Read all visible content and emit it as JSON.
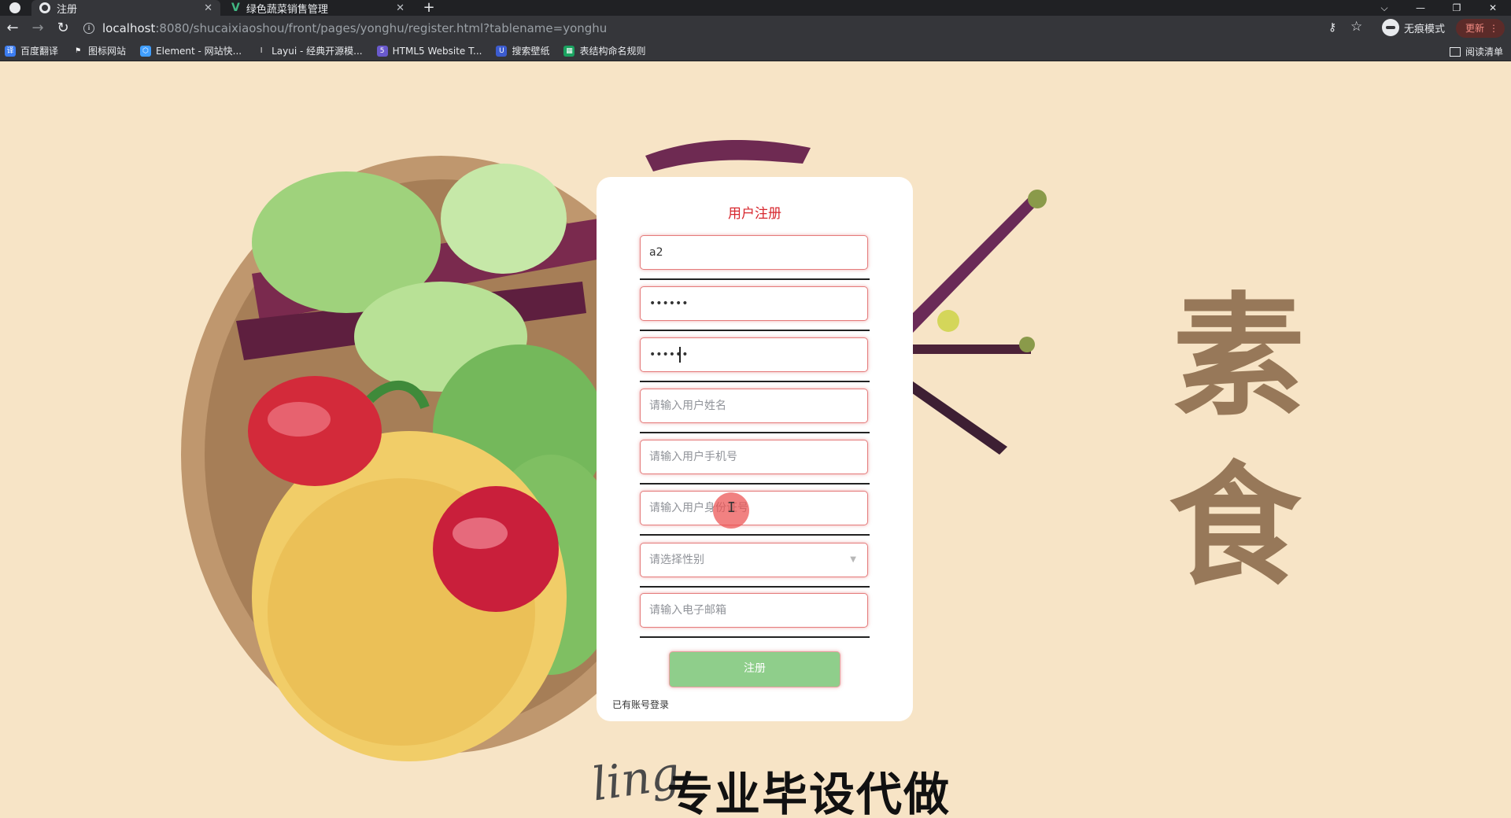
{
  "browser": {
    "tabs": [
      {
        "title": "注册",
        "close": "✕"
      },
      {
        "title": "绿色蔬菜销售管理",
        "close": "✕"
      }
    ],
    "new_tab": "+",
    "window_controls": [
      "⌵",
      "—",
      "❐",
      "✕"
    ],
    "nav": {
      "back": "←",
      "forward": "→",
      "reload": "↻"
    },
    "url_host": "localhost",
    "url_rest": ":8080/shucaixiaoshou/front/pages/yonghu/register.html?tablename=yonghu",
    "incognito_label": "无痕模式",
    "update_label": "更新",
    "update_menu": "⋮",
    "bookmarks": [
      {
        "label": "百度翻译",
        "icon": "baidu-translate-icon",
        "color": "#3b7cf0",
        "glyph": "译"
      },
      {
        "label": "图标网站",
        "icon": "flag-icon",
        "color": "#35363a",
        "glyph": "⚑"
      },
      {
        "label": "Element - 网站快...",
        "icon": "element-icon",
        "color": "#409eff",
        "glyph": "⬡"
      },
      {
        "label": "Layui - 经典开源模...",
        "icon": "layui-icon",
        "color": "#35363a",
        "glyph": "l"
      },
      {
        "label": "HTML5 Website T...",
        "icon": "html5-icon",
        "color": "#6a5acd",
        "glyph": "5"
      },
      {
        "label": "搜索壁纸",
        "icon": "wallpaper-icon",
        "color": "#3c5ccf",
        "glyph": "U"
      },
      {
        "label": "表结构命名规则",
        "icon": "sheet-icon",
        "color": "#1aa260",
        "glyph": "▦"
      }
    ],
    "reading_list": "阅读清单"
  },
  "page": {
    "side_chars": [
      "素",
      "食"
    ],
    "watermark_script": "ling",
    "watermark": "专业毕设代做"
  },
  "form": {
    "title": "用户注册",
    "fields": [
      {
        "name": "username-input",
        "type": "text",
        "value": "a2",
        "placeholder": ""
      },
      {
        "name": "password-input",
        "type": "password",
        "value": "••••••",
        "placeholder": ""
      },
      {
        "name": "confirm-password-input",
        "type": "password",
        "value": "••••••",
        "placeholder": ""
      },
      {
        "name": "real-name-input",
        "type": "text",
        "value": "",
        "placeholder": "请输入用户姓名"
      },
      {
        "name": "phone-input",
        "type": "text",
        "value": "",
        "placeholder": "请输入用户手机号"
      },
      {
        "name": "id-card-input",
        "type": "text",
        "value": "",
        "placeholder": "请输入用户身份证号"
      }
    ],
    "gender_select": {
      "placeholder": "请选择性别",
      "caret": "▼"
    },
    "email": {
      "value": "",
      "placeholder": "请输入电子邮箱"
    },
    "submit_label": "注册",
    "login_link": "已有账号登录"
  },
  "colors": {
    "title_red": "#d7262d",
    "button_green": "#8fce8b",
    "background": "#f7e4c6"
  }
}
